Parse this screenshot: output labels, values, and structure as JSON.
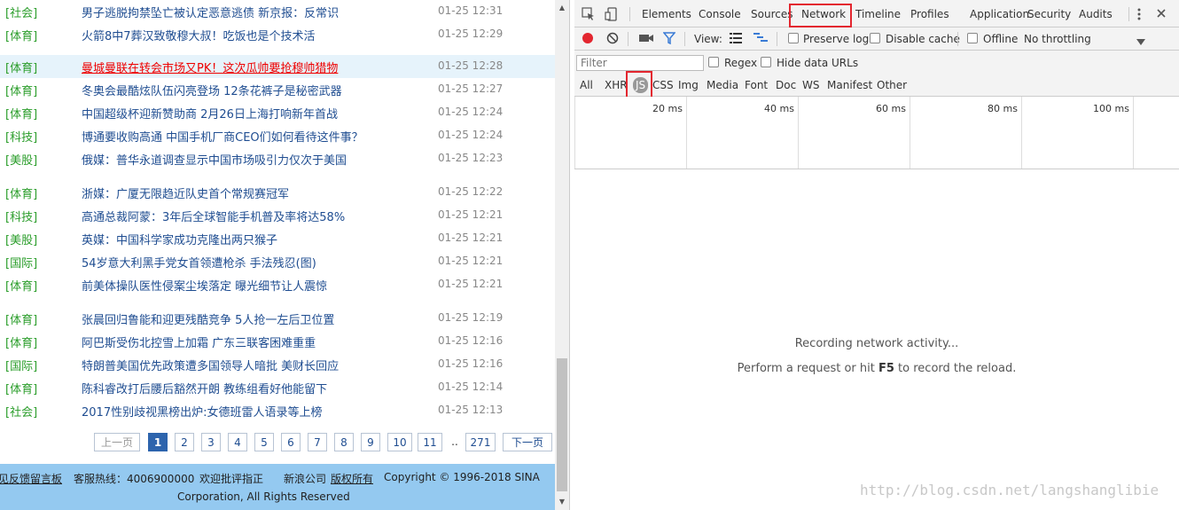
{
  "news": [
    {
      "cat": "[社会]",
      "title": "男子逃脱拘禁坠亡被认定恶意逃债 新京报：反常识",
      "time": "01-25 12:31"
    },
    {
      "cat": "[体育]",
      "title": "火箭8中7葬汉致敬穆大叔！吃饭也是个技术活",
      "time": "01-25 12:29"
    },
    {
      "cat": "[体育]",
      "title": "曼城曼联在转会市场又PK！这次瓜帅要抢穆帅猎物",
      "time": "01-25 12:28",
      "highlight": true
    },
    {
      "cat": "[体育]",
      "title": "冬奥会最酷炫队伍闪亮登场 12条花裤子是秘密武器",
      "time": "01-25 12:27"
    },
    {
      "cat": "[体育]",
      "title": "中国超级杯迎新赞助商 2月26日上海打响新年首战",
      "time": "01-25 12:24"
    },
    {
      "cat": "[科技]",
      "title": "博通要收购高通 中国手机厂商CEO们如何看待这件事？",
      "time": "01-25 12:24"
    },
    {
      "cat": "[美股]",
      "title": "俄媒：普华永道调查显示中国市场吸引力仅次于美国",
      "time": "01-25 12:23"
    },
    {
      "cat": "[体育]",
      "title": "浙媒：广厦无限趋近队史首个常规赛冠军",
      "time": "01-25 12:22"
    },
    {
      "cat": "[科技]",
      "title": "高通总裁阿蒙：3年后全球智能手机普及率将达58%",
      "time": "01-25 12:21"
    },
    {
      "cat": "[美股]",
      "title": "英媒：中国科学家成功克隆出两只猴子",
      "time": "01-25 12:21"
    },
    {
      "cat": "[国际]",
      "title": "54岁意大利黑手党女首领遭枪杀 手法残忍(图)",
      "time": "01-25 12:21"
    },
    {
      "cat": "[体育]",
      "title": "前美体操队医性侵案尘埃落定 曝光细节让人震惊",
      "time": "01-25 12:21"
    },
    {
      "cat": "[体育]",
      "title": "张晨回归鲁能和迎更残酷竞争 5人抢一左后卫位置",
      "time": "01-25 12:19"
    },
    {
      "cat": "[体育]",
      "title": "阿巴斯受伤北控雪上加霜 广东三联客困难重重",
      "time": "01-25 12:16"
    },
    {
      "cat": "[国际]",
      "title": "特朗普美国优先政策遭多国领导人暗批 美财长回应",
      "time": "01-25 12:16"
    },
    {
      "cat": "[体育]",
      "title": "陈科睿改打后腰后豁然开朗 教练组看好他能留下",
      "time": "01-25 12:14"
    },
    {
      "cat": "[社会]",
      "title": "2017性别歧视黑榜出炉:女德班雷人语录等上榜",
      "time": "01-25 12:13"
    }
  ],
  "pager": {
    "prev": "上一页",
    "pages": [
      "1",
      "2",
      "3",
      "4",
      "5",
      "6",
      "7",
      "8",
      "9",
      "10",
      "11"
    ],
    "current": "1",
    "dots": "..",
    "last": "271",
    "next": "下一页"
  },
  "footer": {
    "feedback": "见反馈留言板",
    "hotline": "客服热线：4006900000",
    "welcome": "欢迎批评指正",
    "company": "新浪公司",
    "rights": "版权所有",
    "copyright": "Copyright © 1996-2018 SINA",
    "corp": "Corporation, All Rights Reserved"
  },
  "devtools": {
    "tabs": [
      "Elements",
      "Console",
      "Sources",
      "Network",
      "Timeline",
      "Profiles",
      "Application",
      "Security",
      "Audits"
    ],
    "active_tab": "Network",
    "toolbar": {
      "view": "View:",
      "preserve_log": "Preserve log",
      "disable_cache": "Disable cache",
      "offline": "Offline",
      "throttling": "No throttling"
    },
    "filter": {
      "placeholder": "Filter",
      "regex": "Regex",
      "hide_data_urls": "Hide data URLs",
      "types": [
        "All",
        "XHR",
        "JS",
        "CSS",
        "Img",
        "Media",
        "Font",
        "Doc",
        "WS",
        "Manifest",
        "Other"
      ],
      "selected_type": "JS"
    },
    "timeline_ticks": [
      "20 ms",
      "40 ms",
      "60 ms",
      "80 ms",
      "100 ms"
    ],
    "empty": {
      "line1": "Recording network activity...",
      "line2_pre": "Perform a request or hit ",
      "line2_key": "F5",
      "line2_post": " to record the reload."
    },
    "colors": {
      "record": "#e3262f",
      "highlight_box": "#e3262f",
      "filter_blue": "#3a7bd5"
    }
  },
  "watermark": "http://blog.csdn.net/langshanglibie"
}
